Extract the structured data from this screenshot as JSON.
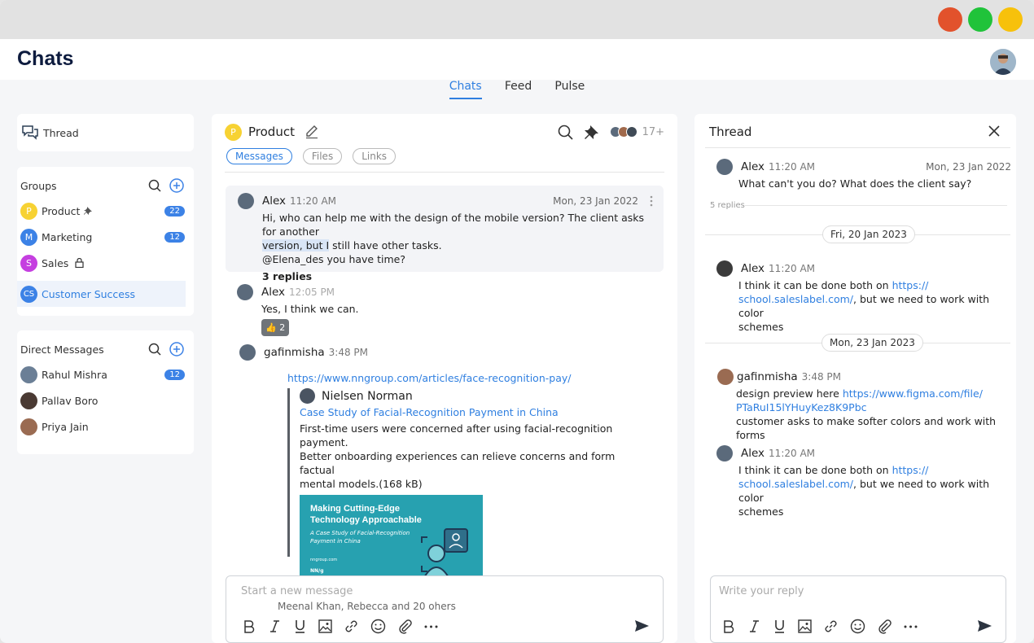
{
  "app": {
    "title": "Chats"
  },
  "main_tabs": [
    {
      "label": "Chats"
    },
    {
      "label": "Feed"
    },
    {
      "label": "Pulse"
    }
  ],
  "sidebar": {
    "thread_link": "Thread",
    "groups_title": "Groups",
    "groups": [
      {
        "initial": "P",
        "name": "Product",
        "badge": "22",
        "color": "#f7d233"
      },
      {
        "initial": "M",
        "name": "Marketing",
        "badge": "12",
        "color": "#3c82e6"
      },
      {
        "initial": "S",
        "name": "Sales",
        "badge": "",
        "color": "#c53fe0"
      },
      {
        "initial": "CS",
        "name": "Customer Success",
        "badge": "",
        "color": "#3c82e6"
      }
    ],
    "dm_title": "Direct Messages",
    "dms": [
      {
        "name": "Rahul Mishra",
        "badge": "12"
      },
      {
        "name": "Pallav Boro",
        "badge": ""
      },
      {
        "name": "Priya Jain",
        "badge": ""
      }
    ]
  },
  "chat": {
    "initial": "P",
    "name": "Product",
    "member_count": "17+",
    "subtabs": [
      "Messages",
      "Files",
      "Links"
    ],
    "messages": [
      {
        "author": "Alex",
        "time": "11:20 AM",
        "date": "Mon, 23 Jan 2022",
        "line1": "Hi, who can help me with the design of the mobile version? The client asks for another",
        "line2_hl": "version, but I",
        "line2_rest": " still have other tasks.",
        "line3": "@Elena_des   you have time?",
        "replies": "3 replies"
      },
      {
        "author": "Alex",
        "time": "12:05 PM",
        "text": "Yes, I think we can.",
        "reaction": "👍 2"
      },
      {
        "author": "gafinmisha",
        "time": "3:48 PM",
        "link": "https://www.nngroup.com/articles/face-recognition-pay/"
      }
    ],
    "preview": {
      "title": "Nielsen Norman",
      "subtitle": "Case Study of Facial-Recognition Payment in China",
      "desc1": "First-time users were concerned after using facial-recognition payment.",
      "desc2": "Better onboarding experiences can relieve concerns and form factual",
      "desc3": "mental models.(168 kB)",
      "img_title1": "Making Cutting-Edge",
      "img_title2": "Technology Approachable",
      "img_sub1": "A Case Study of Facial-Recognition",
      "img_sub2": "Payment in China",
      "img_site": "nngroup.com",
      "img_brand": "NN/g"
    },
    "composer": {
      "placeholder": "Start a new message",
      "typing": "Meenal Khan, Rebecca and 20 ohers"
    }
  },
  "thread": {
    "title": "Thread",
    "root": {
      "author": "Alex",
      "time": "11:20 AM",
      "date": "Mon, 23 Jan 2022",
      "text": "What can't you do? What does the client say?",
      "replies": "5 replies"
    },
    "dates": [
      "Fri, 20 Jan 2023",
      "Mon, 23 Jan 2023"
    ],
    "replies": [
      {
        "author": "Alex",
        "time": "11:20 AM",
        "pre": "I think it can be done both on ",
        "link1": "https://",
        "link2": "school.saleslabel.com/",
        "post": ", but we need to work with color",
        "post2": "schemes"
      },
      {
        "author": "gafinmisha",
        "time": "3:48 PM",
        "pre": "design preview here ",
        "link1": "https://www.figma.com/file/",
        "link2": "PTaRuI15lYHuyKez8K9Pbc",
        "post2": "customer asks to make softer colors and work with forms"
      },
      {
        "author": "Alex",
        "time": "11:20 AM",
        "pre": "I think it can be done both on ",
        "link1": "https://",
        "link2": "school.saleslabel.com/",
        "post": ", but we need to work with color",
        "post2": "schemes"
      }
    ],
    "composer": {
      "placeholder": "Write your reply"
    }
  }
}
